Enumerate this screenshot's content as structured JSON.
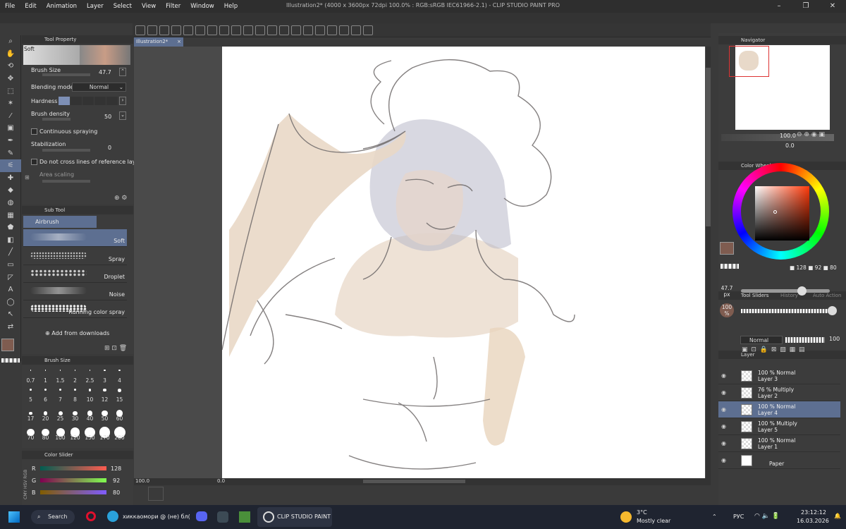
{
  "menu": [
    "File",
    "Edit",
    "Animation",
    "Layer",
    "Select",
    "View",
    "Filter",
    "Window",
    "Help"
  ],
  "window_title": "Illustration2* (4000 x 3600px 72dpi 100.0% : RGB:sRGB IEC61966-2.1) - CLIP STUDIO PAINT PRO",
  "doc_tab": "Illustration2*",
  "tool_property": {
    "title": "Tool Property",
    "preset": "Soft",
    "brush_size_label": "Brush Size",
    "brush_size": "47.7",
    "blending_label": "Blending mode",
    "blending": "Normal",
    "hardness_label": "Hardness",
    "density_label": "Brush density",
    "density": "50",
    "continuous": "Continuous spraying",
    "stabilization_label": "Stabilization",
    "stabilization": "0",
    "no_cross": "Do not cross lines of reference layer",
    "area_scaling": "Area scaling"
  },
  "sub_tool": {
    "title": "Sub Tool",
    "group": "Airbrush",
    "items": [
      "Soft",
      "Spray",
      "Droplet",
      "Noise",
      "Running color spray"
    ],
    "add": "Add from downloads"
  },
  "brush_size_panel": {
    "title": "Brush Size",
    "sizes": [
      "0.7",
      "1",
      "1.5",
      "2",
      "2.5",
      "3",
      "4",
      "5",
      "6",
      "7",
      "8",
      "10",
      "12",
      "15",
      "17",
      "20",
      "25",
      "30",
      "40",
      "50",
      "60",
      "70",
      "80",
      "100",
      "120",
      "150",
      "170",
      "200"
    ]
  },
  "color_slider": {
    "title": "Color Slider",
    "mode_tabs": "CMY HSV RGB",
    "r_label": "R",
    "r": "128",
    "g_label": "G",
    "g": "92",
    "b_label": "B",
    "b": "80"
  },
  "canvas_status": {
    "zoom": "100.0",
    "angle": "0.0"
  },
  "navigator": {
    "title": "Navigator",
    "zoom": "100.0",
    "rotation": "0.0"
  },
  "color_wheel": {
    "title": "Color Wheel",
    "r": "128",
    "g": "92",
    "b": "80"
  },
  "tool_sliders": {
    "title": "Tool Sliders",
    "tab2": "History",
    "tab3": "Auto Action",
    "size": "47.7",
    "size_unit": "px",
    "opacity": "100",
    "opacity_unit": "%"
  },
  "layer_panel": {
    "title": "Layer",
    "blend": "Normal",
    "opacity": "100",
    "layers": [
      {
        "mode": "100 % Normal",
        "name": "Layer 3"
      },
      {
        "mode": "76 % Multiply",
        "name": "Layer 2"
      },
      {
        "mode": "100 % Normal",
        "name": "Layer 4"
      },
      {
        "mode": "100 % Multiply",
        "name": "Layer 5"
      },
      {
        "mode": "100 % Normal",
        "name": "Layer 1"
      }
    ],
    "paper": "Paper"
  },
  "taskbar": {
    "search": "Search",
    "telegram": "хиккаомори @ (не) бл(",
    "app": "CLIP STUDIO PAINT",
    "temp": "3°C",
    "weather": "Mostly clear",
    "lang": "РУС",
    "time": "23:12:12",
    "date": "16.03.2026"
  },
  "colors": {
    "main": "#7f5c50",
    "accent": "#5d6f91"
  }
}
